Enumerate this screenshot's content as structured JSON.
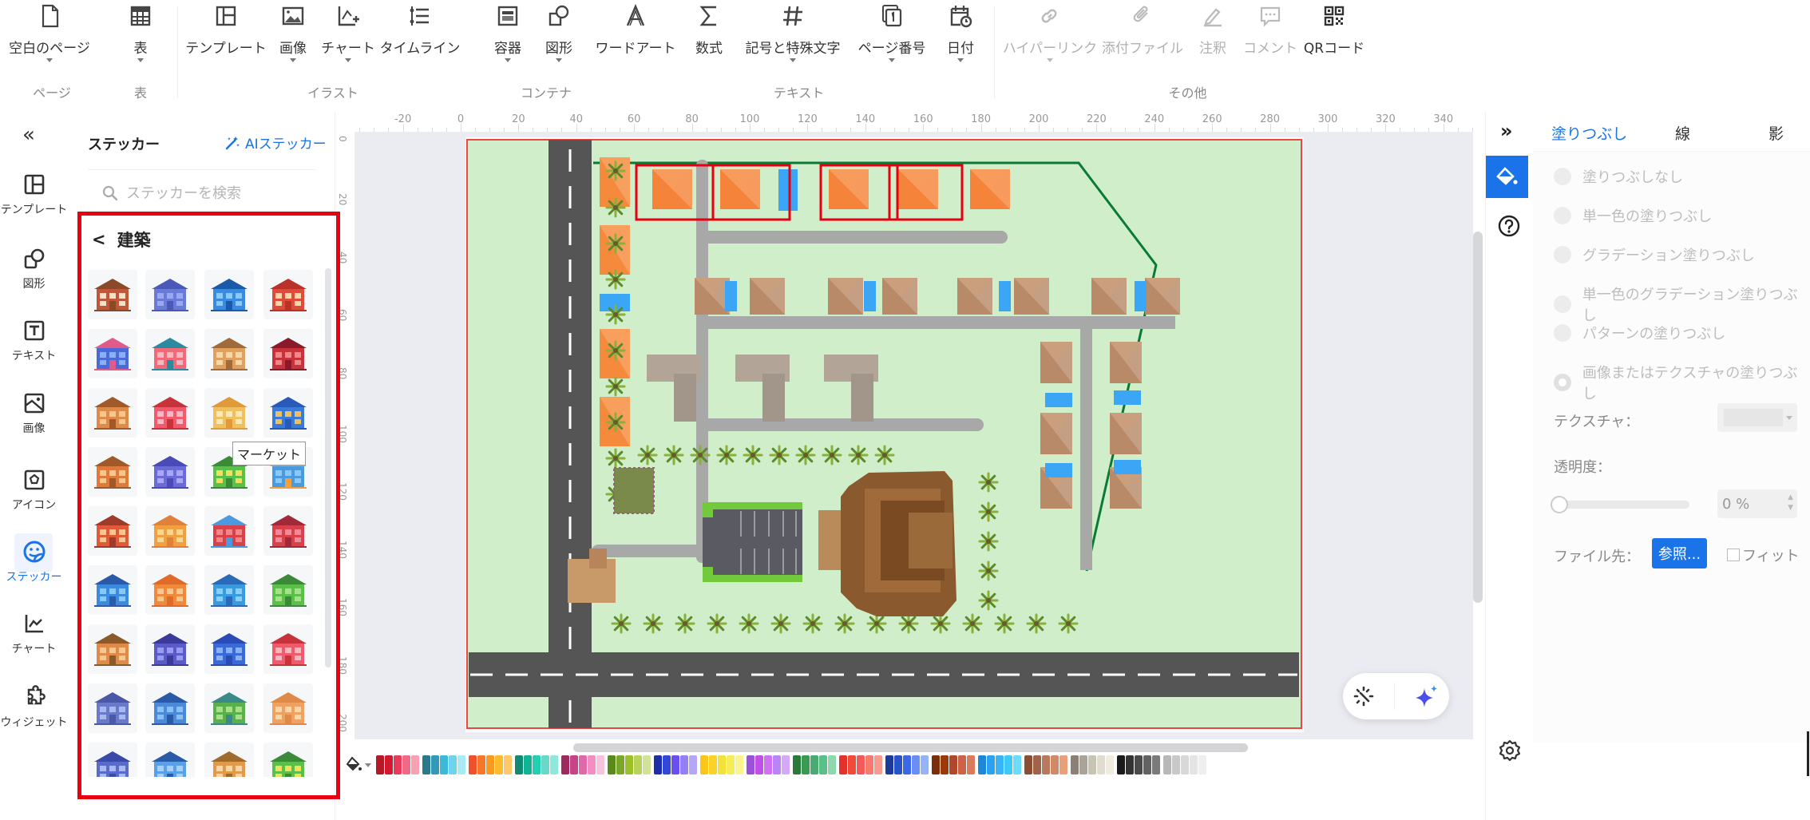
{
  "toolbar": {
    "items": [
      {
        "label": "空白のページ",
        "icon": "blank-page-icon",
        "caret": true,
        "disabled": false
      },
      {
        "label": "表",
        "icon": "table-icon",
        "caret": true,
        "disabled": false
      },
      {
        "label": "テンプレート",
        "icon": "template-icon",
        "caret": false,
        "disabled": false
      },
      {
        "label": "画像",
        "icon": "image-icon",
        "caret": true,
        "disabled": false
      },
      {
        "label": "チャート",
        "icon": "chart-icon",
        "caret": true,
        "disabled": false
      },
      {
        "label": "タイムライン",
        "icon": "timeline-icon",
        "caret": false,
        "disabled": false
      },
      {
        "label": "容器",
        "icon": "container-icon",
        "caret": true,
        "disabled": false
      },
      {
        "label": "図形",
        "icon": "shapes-icon",
        "caret": true,
        "disabled": false
      },
      {
        "label": "ワードアート",
        "icon": "wordart-icon",
        "caret": false,
        "disabled": false
      },
      {
        "label": "数式",
        "icon": "formula-icon",
        "caret": false,
        "disabled": false
      },
      {
        "label": "記号と特殊文字",
        "icon": "symbol-icon",
        "caret": true,
        "disabled": false
      },
      {
        "label": "ページ番号",
        "icon": "page-number-icon",
        "caret": true,
        "disabled": false
      },
      {
        "label": "日付",
        "icon": "date-icon",
        "caret": true,
        "disabled": false
      },
      {
        "label": "ハイパーリンク",
        "icon": "hyperlink-icon",
        "caret": true,
        "disabled": true
      },
      {
        "label": "添付ファイル",
        "icon": "attachment-icon",
        "caret": false,
        "disabled": true
      },
      {
        "label": "注釈",
        "icon": "annotation-icon",
        "caret": false,
        "disabled": true
      },
      {
        "label": "コメント",
        "icon": "comment-icon",
        "caret": false,
        "disabled": true
      },
      {
        "label": "QRコード",
        "icon": "qr-code-icon",
        "caret": false,
        "disabled": false
      }
    ],
    "groups": [
      "ページ",
      "表",
      "イラスト",
      "コンテナ",
      "テキスト",
      "その他"
    ]
  },
  "left_rail": {
    "collapse_icon": "double-chevron-left-icon",
    "items": [
      {
        "label": "テンプレート",
        "icon": "template-icon",
        "active": false
      },
      {
        "label": "図形",
        "icon": "shapes-icon",
        "active": false
      },
      {
        "label": "テキスト",
        "icon": "text-icon",
        "active": false
      },
      {
        "label": "画像",
        "icon": "image-icon",
        "active": false
      },
      {
        "label": "アイコン",
        "icon": "icon-library-icon",
        "active": false
      },
      {
        "label": "ステッカー",
        "icon": "sticker-icon",
        "active": true
      },
      {
        "label": "チャート",
        "icon": "chart-icon",
        "active": false
      },
      {
        "label": "ウィジェット",
        "icon": "widget-icon",
        "active": false
      }
    ]
  },
  "sticker_panel": {
    "title": "ステッカー",
    "ai_button": "AIステッカー",
    "search_placeholder": "ステッカーを検索",
    "category": "建築",
    "tooltip": "マーケット",
    "stickers": [
      "convenience-store",
      "suburban-house",
      "blue-hospital",
      "red-storefront",
      "blue-shop-house",
      "pink-shop",
      "cathedral",
      "red-cottage",
      "twin-tower-church",
      "pink-store",
      "yellow-school",
      "blue-supermarket",
      "orange-house",
      "blue-church",
      "market",
      "factory",
      "red-villa",
      "yellow-apartment",
      "red-chapel",
      "red-victorian-house",
      "blue-boutique",
      "orange-apartment",
      "blue-office",
      "green-house",
      "orange-townhall",
      "purple-castle",
      "blue-capitol",
      "red-apartment",
      "blue-bungalow",
      "blue-skyscraper",
      "green-store",
      "orange-museum",
      "blue-cafe",
      "blue-office-block",
      "orange-bank",
      "green-station"
    ]
  },
  "ruler": {
    "top_labels": [
      "0",
      "-20",
      "0",
      "20",
      "40",
      "60",
      "80",
      "100",
      "120",
      "140",
      "160",
      "180",
      "200",
      "220",
      "240",
      "260",
      "280",
      "300",
      "320",
      "340"
    ],
    "left_labels": [
      "0",
      "20",
      "40",
      "60",
      "80",
      "100",
      "120",
      "140",
      "160",
      "180",
      "200"
    ]
  },
  "canvas": {
    "description": "site plan",
    "colors": {
      "grass": "#cfeec9",
      "road": "#555555",
      "path": "#a8a8a8",
      "orange_roof": "#f58a3c",
      "brown_roof": "#b88a68",
      "pool": "#3aa6f5",
      "boundary": "#0a7a35",
      "selection": "#e60012"
    }
  },
  "float_actions": {
    "left_icon": "magic-wand-icon",
    "right_icon": "ai-sparkle-icon"
  },
  "palette": {
    "fill_icon": "paint-bucket-icon",
    "colors": [
      "#b51826",
      "#d3182f",
      "#e63c5a",
      "#f06a86",
      "#f7a1b3",
      "#2a7a8c",
      "#3399b8",
      "#3db8d8",
      "#6fd3ec",
      "#a8eaf6",
      "#f0502a",
      "#f7772a",
      "#fa9a1e",
      "#fbbb2a",
      "#fcc868",
      "#128a74",
      "#12b294",
      "#22cfb0",
      "#6ad8c8",
      "#8ee8dc",
      "#9c2a5a",
      "#c84488",
      "#e06aa8",
      "#f28ec4",
      "#f6c2dc",
      "#5a8a1a",
      "#7aa62a",
      "#9cc02a",
      "#b8d25a",
      "#d2e29a",
      "#1e2ea8",
      "#3448d8",
      "#6a4ef0",
      "#9480f4",
      "#b4a8f6",
      "#fbc61a",
      "#fad22a",
      "#f2e23a",
      "#f6ec5a",
      "#f9f48e",
      "#9a52d8",
      "#c050e8",
      "#d070f2",
      "#b884f6",
      "#d6a8fa",
      "#2a7a3a",
      "#3a9a52",
      "#4aaa72",
      "#5abf88",
      "#8ed8ae",
      "#e4322a",
      "#f04a3a",
      "#f45a5a",
      "#f67a6e",
      "#f89a90",
      "#1e3a9a",
      "#2a52c8",
      "#3a68e6",
      "#6a8ef4",
      "#94b4f6",
      "#7a2e0a",
      "#9a3a0a",
      "#b2482a",
      "#cc6248",
      "#dc7a5e",
      "#1e88d8",
      "#2aa2f0",
      "#3ab4f6",
      "#3ec8f4",
      "#6cdcfa",
      "#8a4e32",
      "#a06248",
      "#b87a5e",
      "#d08a68",
      "#e8a07a",
      "#8a8078",
      "#aaa498",
      "#c8c4b4",
      "#e2dcd0",
      "#f2ecde",
      "#1a1a1a",
      "#333333",
      "#4a4a4a",
      "#626262",
      "#7a7a7a",
      "#b8b8b8",
      "#c8c8c8",
      "#d8d8d8",
      "#e4e4e4",
      "#efefef"
    ]
  },
  "right_panel": {
    "expand_icon": "double-chevron-right-icon",
    "tabs": [
      {
        "label": "塗りつぶし",
        "active": true
      },
      {
        "label": "線",
        "active": false
      },
      {
        "label": "影",
        "active": false
      }
    ],
    "fill_options": [
      {
        "label": "塗りつぶしなし",
        "checked": false
      },
      {
        "label": "単一色の塗りつぶし",
        "checked": false
      },
      {
        "label": "グラデーション塗りつぶし",
        "checked": false
      },
      {
        "label": "単一色のグラデーション塗りつぶし",
        "checked": false
      },
      {
        "label": "パターンの塗りつぶし",
        "checked": false
      },
      {
        "label": "画像またはテクスチャの塗りつぶし",
        "checked": true
      }
    ],
    "texture_label": "テクスチャ：",
    "transparency_label": "透明度：",
    "transparency_value": "0 %",
    "transparency_percent": 0,
    "file_label": "ファイル先：",
    "browse_button": "参照...",
    "fit_label": "フィット",
    "fit_checked": false,
    "accent": "#1a73e8"
  }
}
